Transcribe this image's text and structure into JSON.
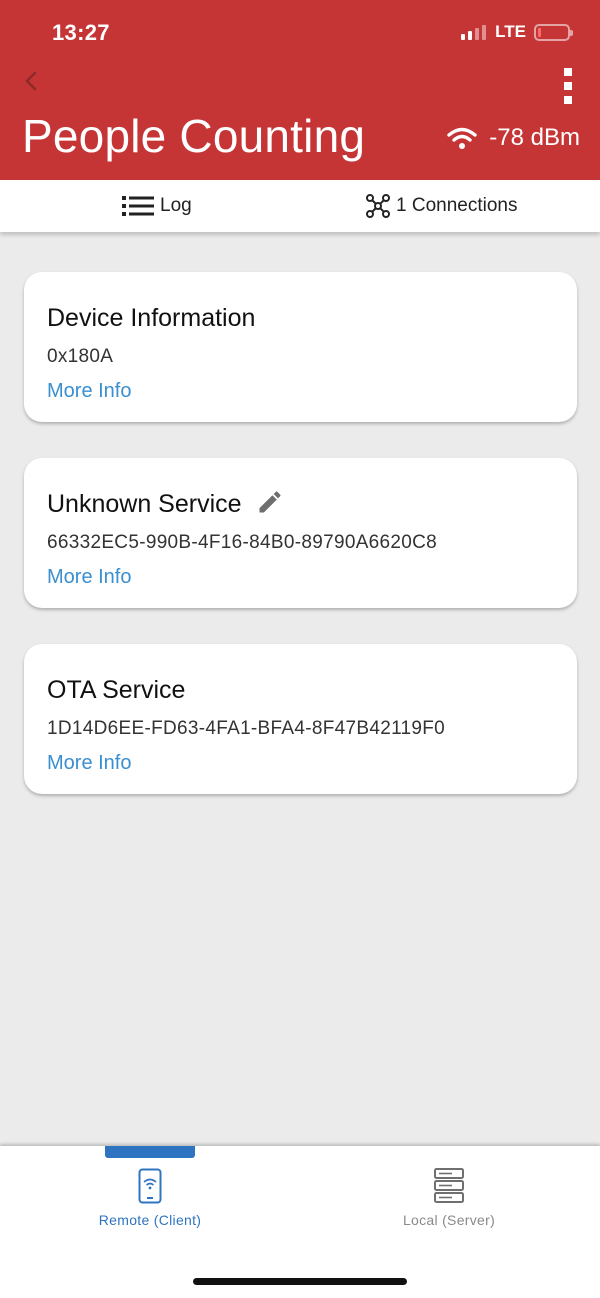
{
  "status_bar": {
    "time": "13:27",
    "network": "LTE"
  },
  "header": {
    "title": "People Counting",
    "rssi": "-78 dBm",
    "background": "#c63536"
  },
  "tabs": [
    {
      "label": "Log",
      "icon": "list-icon"
    },
    {
      "label": "1 Connections",
      "icon": "network-icon"
    }
  ],
  "services": [
    {
      "name": "Device Information",
      "uuid": "0x180A",
      "link": "More Info"
    },
    {
      "name": "Unknown Service",
      "uuid": "66332EC5-990B-4F16-84B0-89790A6620C8",
      "link": "More Info",
      "editable": true
    },
    {
      "name": "OTA Service",
      "uuid": "1D14D6EE-FD63-4FA1-BFA4-8F47B42119F0",
      "link": "More Info"
    }
  ],
  "bottom_nav": [
    {
      "label": "Remote (Client)",
      "icon": "phone-wifi-icon",
      "active": true
    },
    {
      "label": "Local (Server)",
      "icon": "server-icon",
      "active": false
    }
  ],
  "colors": {
    "accent": "#2f74c0",
    "link": "#3a8fd1"
  }
}
